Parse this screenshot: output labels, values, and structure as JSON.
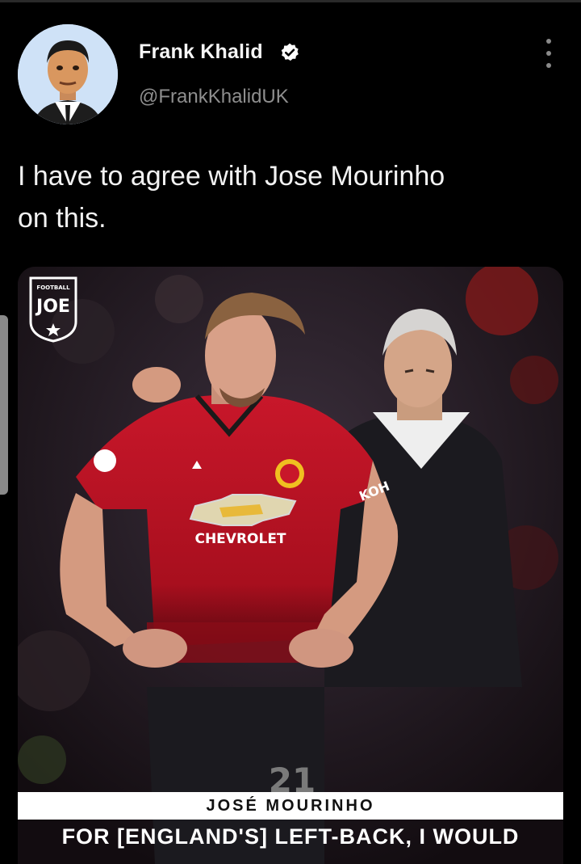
{
  "author": {
    "display_name": "Frank Khalid",
    "handle": "@FrankKhalidUK",
    "verified": true,
    "avatar_icon": "cartoon-avatar-icon"
  },
  "tweet": {
    "text_line1": "I have to agree with Jose Mourinho",
    "text_line2": "on this."
  },
  "media": {
    "watermark_top": "FOOTBALL",
    "watermark_main": "JOE",
    "shirt_sponsor": "CHEVROLET",
    "sleeve_text": "KOH",
    "shirt_number": "21",
    "caption_name": "JOSÉ MOURINHO",
    "caption_quote": "FOR [ENGLAND'S] LEFT-BACK, I WOULD"
  },
  "colors": {
    "background": "#000000",
    "handle_gray": "#8e8e8e",
    "kit_red": "#b8121f",
    "verified_badge": "#ffffff"
  }
}
